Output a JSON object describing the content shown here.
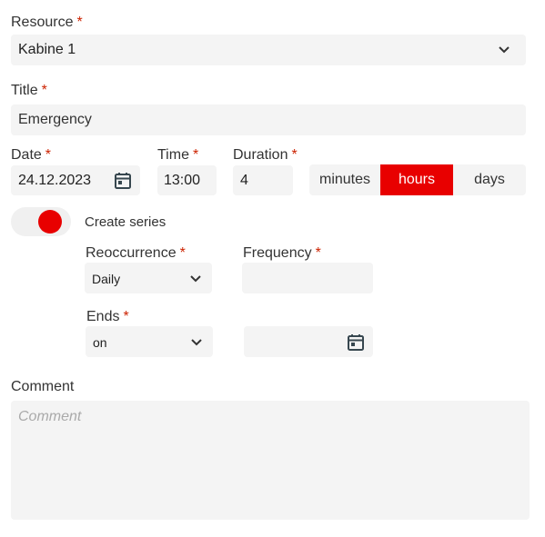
{
  "resource": {
    "label": "Resource",
    "required": "*",
    "value": "Kabine 1",
    "icon": "chevron-down-icon"
  },
  "title": {
    "label": "Title",
    "required": "*",
    "value": "Emergency"
  },
  "date": {
    "label": "Date",
    "required": "*",
    "value": "24.12.2023",
    "icon": "calendar-icon"
  },
  "time": {
    "label": "Time",
    "required": "*",
    "value": "13:00"
  },
  "duration": {
    "label": "Duration",
    "required": "*",
    "value": "4",
    "units": [
      "minutes",
      "hours",
      "days"
    ],
    "selected_unit": "hours"
  },
  "series": {
    "label": "Create series",
    "enabled": true,
    "icon": "toggle-switch"
  },
  "reoccurrence": {
    "label": "Reoccurrence",
    "required": "*",
    "value": "Daily",
    "icon": "chevron-down-icon"
  },
  "frequency": {
    "label": "Frequency",
    "required": "*",
    "value": ""
  },
  "ends": {
    "label": "Ends",
    "required": "*",
    "value": "on",
    "date_value": "",
    "icon": "chevron-down-icon",
    "date_icon": "calendar-icon"
  },
  "comment": {
    "label": "Comment",
    "placeholder": "Comment",
    "value": ""
  },
  "colors": {
    "accent": "#e80000",
    "field_bg": "#f4f4f4",
    "required_star": "#cc2200",
    "icon": "#37474f"
  }
}
